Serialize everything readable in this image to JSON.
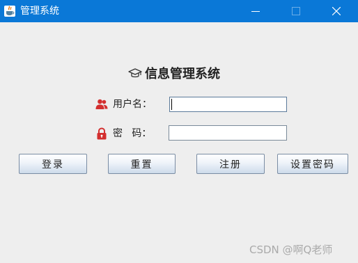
{
  "window": {
    "title": "管理系统",
    "title_bar_color": "#0a78d7",
    "icons": {
      "app": "java-cup-icon",
      "minimize": "minimize-icon",
      "maximize": "maximize-icon",
      "close": "close-icon"
    }
  },
  "form": {
    "heading": "信息管理系统",
    "heading_icon": "graduation-cap-icon",
    "username_label": "用户名：",
    "username_icon": "users-icon",
    "username_value": "",
    "password_label": "密   码：",
    "password_icon": "lock-icon",
    "password_value": "",
    "icon_color": "#d32f2f"
  },
  "buttons": {
    "login": "登录",
    "reset": "重置",
    "register": "注册",
    "set_password": "设置密码"
  },
  "watermark": "CSDN @啊Q老师"
}
